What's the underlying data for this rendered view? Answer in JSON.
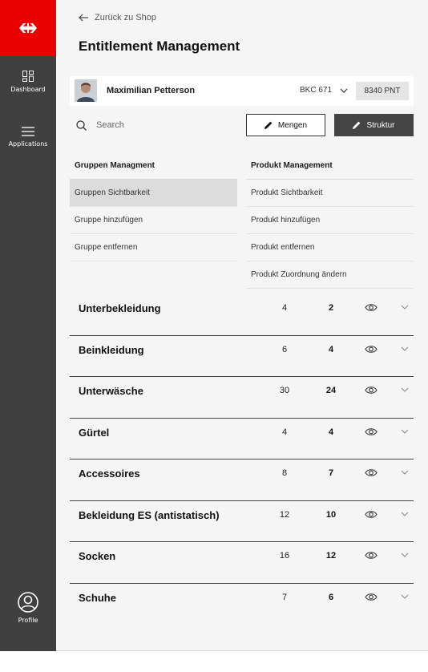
{
  "sidebar": {
    "items": [
      {
        "label": "Dashboard",
        "icon": "dashboard-icon"
      },
      {
        "label": "Applications",
        "icon": "menu-icon"
      }
    ],
    "profile_label": "Profile",
    "brand_color": "#eb0000"
  },
  "header": {
    "back_label": "Zurück zu Shop",
    "title": "Entitlement Management"
  },
  "user": {
    "name": "Maximilian Petterson",
    "account": "BKC 671",
    "points": "8340 PNT"
  },
  "toolbar": {
    "search_placeholder": "Search",
    "mengen_label": "Mengen",
    "struktur_label": "Struktur"
  },
  "gruppen": {
    "heading": "Gruppen Managment",
    "items": [
      "Gruppen Sichtbarkeit",
      "Gruppe hinzufügen",
      "Gruppe entfernen"
    ],
    "active_index": 0
  },
  "produkt": {
    "heading": "Produkt Management",
    "items": [
      "Produkt Sichtbarkeit",
      "Produkt hinzufügen",
      "Produkt entfernen",
      "Produkt Zuordnung ändern"
    ]
  },
  "categories": [
    {
      "name": "Unterbekleidung",
      "count": "4",
      "quantity": "2"
    },
    {
      "name": "Beinkleidung",
      "count": "6",
      "quantity": "4"
    },
    {
      "name": "Unterwäsche",
      "count": "30",
      "quantity": "24"
    },
    {
      "name": "Gürtel",
      "count": "4",
      "quantity": "4"
    },
    {
      "name": "Accessoires",
      "count": "8",
      "quantity": "7"
    },
    {
      "name": "Bekleidung ES (antistatisch)",
      "count": "12",
      "quantity": "10"
    },
    {
      "name": "Socken",
      "count": "16",
      "quantity": "12"
    },
    {
      "name": "Schuhe",
      "count": "7",
      "quantity": "6"
    }
  ]
}
